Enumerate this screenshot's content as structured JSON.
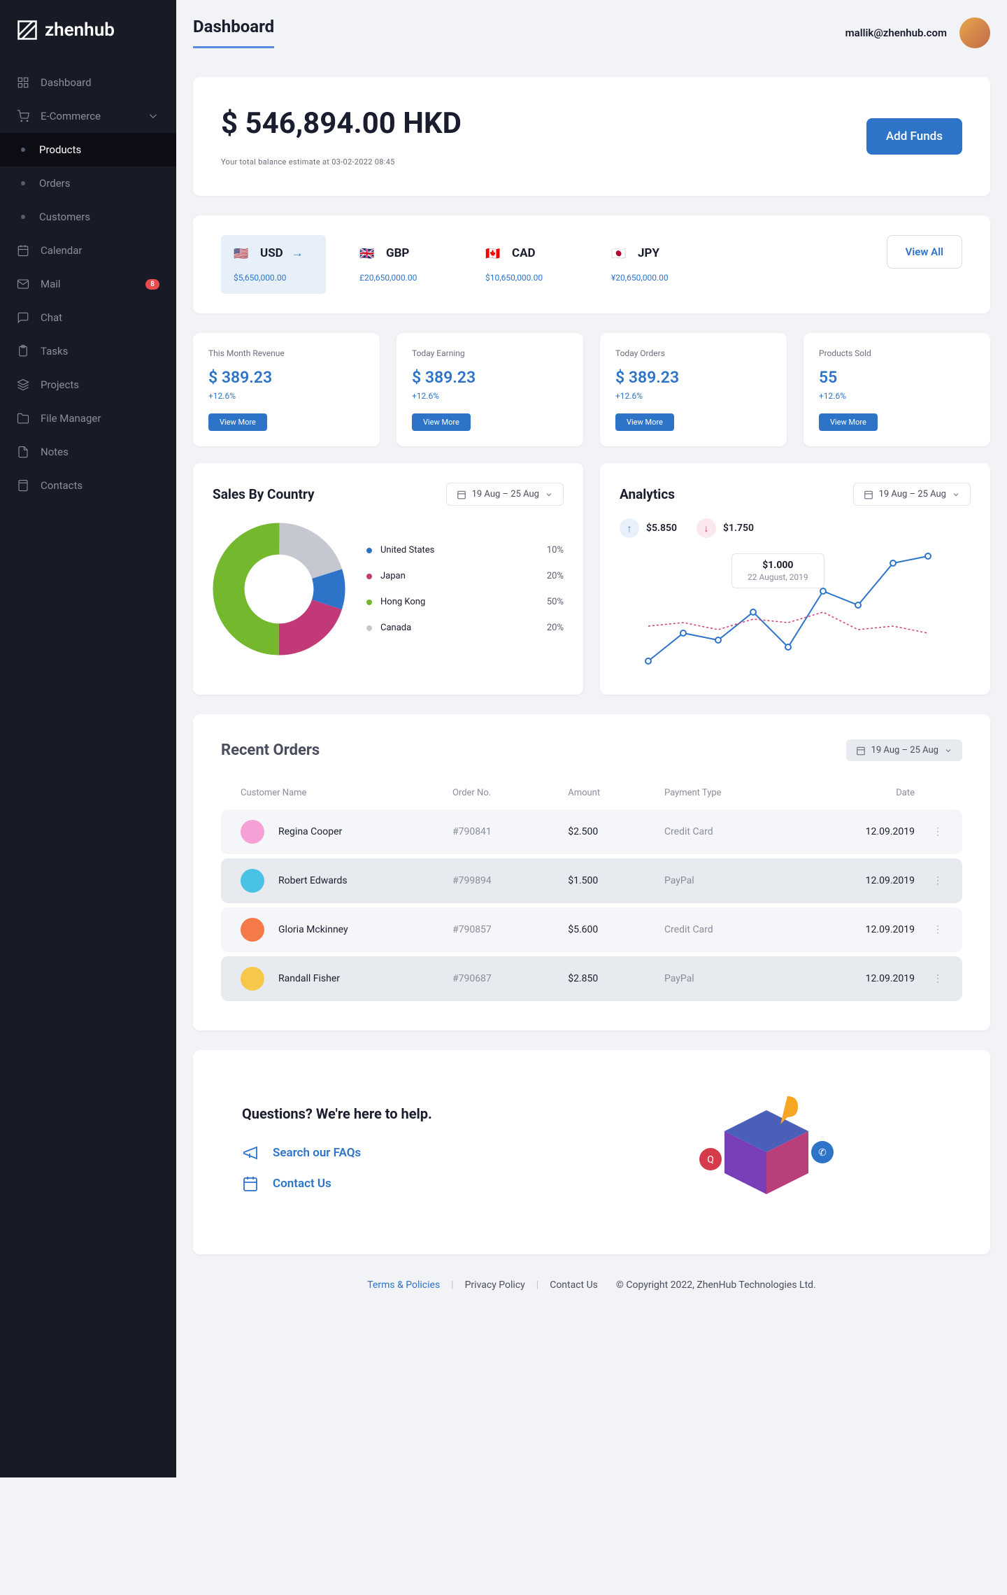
{
  "brand": "zhenhub",
  "page_title": "Dashboard",
  "user_email": "mallik@zhenhub.com",
  "sidebar": {
    "dashboard": "Dashboard",
    "ecommerce": "E-Commerce",
    "products": "Products",
    "orders": "Orders",
    "customers": "Customers",
    "calendar": "Calendar",
    "mail": "Mail",
    "mail_badge": "8",
    "chat": "Chat",
    "tasks": "Tasks",
    "projects": "Projects",
    "file_manager": "File Manager",
    "notes": "Notes",
    "contacts": "Contacts"
  },
  "balance": {
    "amount": "$ 546,894.00 HKD",
    "subtitle": "Your total balance estimate at 03-02-2022 08:45",
    "add_funds": "Add Funds"
  },
  "fx": {
    "view_all": "View All",
    "items": [
      {
        "code": "USD",
        "amount": "$5,650,000.00",
        "flag": "🇺🇸",
        "active": true
      },
      {
        "code": "GBP",
        "amount": "£20,650,000.00",
        "flag": "🇬🇧"
      },
      {
        "code": "CAD",
        "amount": "$10,650,000.00",
        "flag": "🇨🇦"
      },
      {
        "code": "JPY",
        "amount": "¥20,650,000.00",
        "flag": "🇯🇵"
      }
    ]
  },
  "stats": [
    {
      "title": "This Month Revenue",
      "value": "$ 389.23",
      "delta": "+12.6%",
      "btn": "View More"
    },
    {
      "title": "Today Earning",
      "value": "$ 389.23",
      "delta": "+12.6%",
      "btn": "View More"
    },
    {
      "title": "Today Orders",
      "value": "$ 389.23",
      "delta": "+12.6%",
      "btn": "View More"
    },
    {
      "title": "Products Sold",
      "value": "55",
      "delta": "+12.6%",
      "btn": "View More"
    }
  ],
  "sales_country": {
    "title": "Sales By Country",
    "range": "19 Aug – 25 Aug",
    "legend": [
      {
        "label": "United States",
        "value": "10%",
        "color": "#2d74c9"
      },
      {
        "label": "Japan",
        "value": "20%",
        "color": "#c13a77"
      },
      {
        "label": "Hong Kong",
        "value": "50%",
        "color": "#74b82e"
      },
      {
        "label": "Canada",
        "value": "20%",
        "color": "#c5c8d0"
      }
    ]
  },
  "analytics": {
    "title": "Analytics",
    "range": "19 Aug – 25 Aug",
    "up": "$5.850",
    "down": "$1.750",
    "tooltip_amt": "$1.000",
    "tooltip_date": "22 August, 2019"
  },
  "chart_data": [
    {
      "type": "pie",
      "title": "Sales By Country",
      "series": [
        {
          "name": "United States",
          "value": 10,
          "color": "#2d74c9"
        },
        {
          "name": "Japan",
          "value": 20,
          "color": "#c13a77"
        },
        {
          "name": "Hong Kong",
          "value": 50,
          "color": "#74b82e"
        },
        {
          "name": "Canada",
          "value": 20,
          "color": "#c5c8d0"
        }
      ]
    },
    {
      "type": "line",
      "title": "Analytics",
      "x": [
        1,
        2,
        3,
        4,
        5,
        6,
        7,
        8,
        9
      ],
      "series": [
        {
          "name": "up",
          "color": "#2d74c9",
          "values": [
            20,
            60,
            50,
            90,
            40,
            120,
            100,
            160,
            170
          ]
        },
        {
          "name": "down",
          "color": "#d43a6b",
          "values": [
            70,
            75,
            65,
            80,
            75,
            90,
            65,
            70,
            60
          ]
        }
      ],
      "ylim": [
        0,
        180
      ],
      "annotation": {
        "label": "$1.000",
        "sub": "22 August, 2019"
      }
    }
  ],
  "orders": {
    "title": "Recent Orders",
    "range": "19 Aug – 25 Aug",
    "cols": {
      "customer": "Customer Name",
      "order": "Order No.",
      "amount": "Amount",
      "payment": "Payment Type",
      "date": "Date"
    },
    "rows": [
      {
        "name": "Regina Cooper",
        "order": "#790841",
        "amount": "$2.500",
        "payment": "Credit Card",
        "date": "12.09.2019",
        "hi": false,
        "av": "#f5a1d6"
      },
      {
        "name": "Robert Edwards",
        "order": "#799894",
        "amount": "$1.500",
        "payment": "PayPal",
        "date": "12.09.2019",
        "hi": true,
        "av": "#4ac2e6"
      },
      {
        "name": "Gloria Mckinney",
        "order": "#790857",
        "amount": "$5.600",
        "payment": "Credit Card",
        "date": "12.09.2019",
        "hi": false,
        "av": "#f57a4a"
      },
      {
        "name": "Randall Fisher",
        "order": "#790687",
        "amount": "$2.850",
        "payment": "PayPal",
        "date": "12.09.2019",
        "hi": true,
        "av": "#f5c84a"
      }
    ]
  },
  "help": {
    "title": "Questions? We're here to help.",
    "faq": "Search our FAQs",
    "contact": "Contact Us"
  },
  "footer": {
    "terms": "Terms & Policies",
    "privacy": "Privacy Policy",
    "contact": "Contact Us",
    "copyright": "© Copyright 2022, ZhenHub Technologies Ltd."
  }
}
